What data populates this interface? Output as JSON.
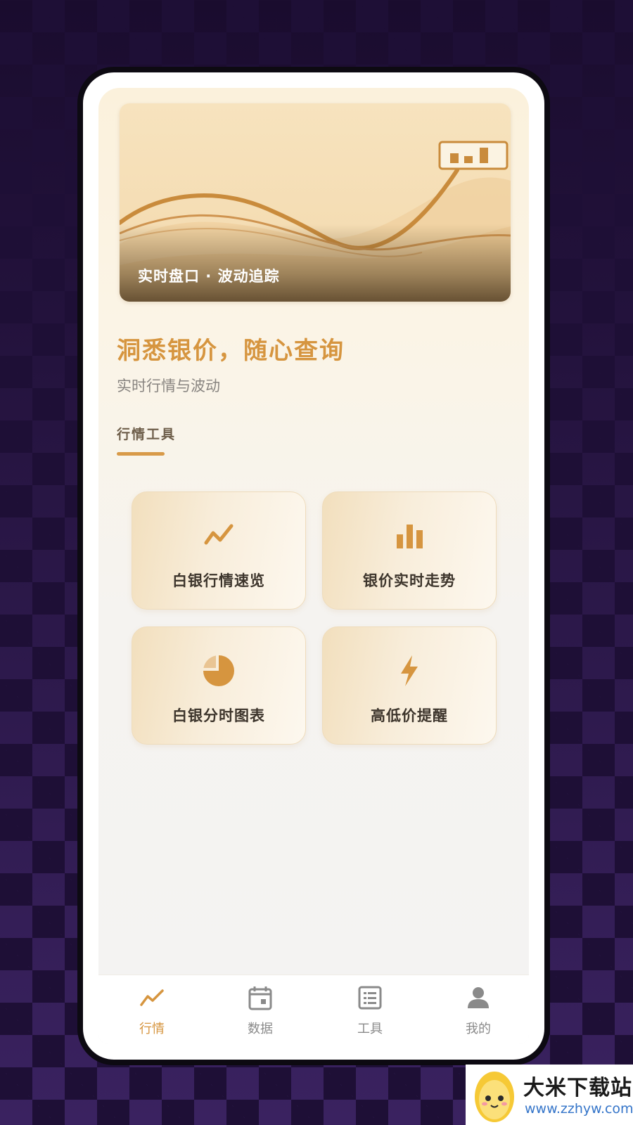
{
  "banner": {
    "caption": "实时盘口 · 波动追踪"
  },
  "hero": {
    "headline": "洞悉银价，随心查询",
    "subline": "实时行情与波动"
  },
  "section": {
    "title": "行情工具"
  },
  "tools": [
    {
      "label": "白银行情速览",
      "icon": "trend-line-icon"
    },
    {
      "label": "银价实时走势",
      "icon": "bar-chart-icon"
    },
    {
      "label": "白银分时图表",
      "icon": "pie-chart-icon"
    },
    {
      "label": "高低价提醒",
      "icon": "lightning-icon"
    }
  ],
  "tabbar": [
    {
      "label": "行情",
      "icon": "trend-line-icon",
      "active": true
    },
    {
      "label": "数据",
      "icon": "calendar-icon",
      "active": false
    },
    {
      "label": "工具",
      "icon": "list-icon",
      "active": false
    },
    {
      "label": "我的",
      "icon": "user-icon",
      "active": false
    }
  ],
  "watermark": {
    "name": "大米下载站",
    "url": "www.zzhyw.com"
  },
  "colors": {
    "accent": "#d6953f",
    "inactive": "#8a8a8a",
    "text": "#3d352c"
  }
}
